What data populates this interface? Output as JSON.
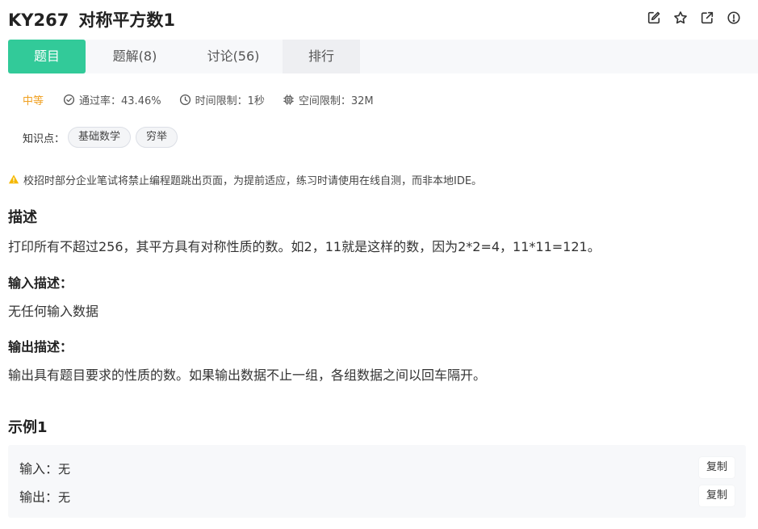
{
  "header": {
    "problem_id": "KY267",
    "problem_title": "对称平方数1",
    "actions": [
      {
        "icon": "edit-icon"
      },
      {
        "icon": "star-icon"
      },
      {
        "icon": "share-icon"
      },
      {
        "icon": "report-icon"
      }
    ]
  },
  "tabs": [
    {
      "label": "题目",
      "active": true
    },
    {
      "label": "题解(8)",
      "active": false
    },
    {
      "label": "讨论(56)",
      "active": false
    },
    {
      "label": "排行",
      "active": false
    }
  ],
  "meta": {
    "difficulty": "中等",
    "pass_rate": "通过率：43.46%",
    "time_limit": "时间限制：1秒",
    "memory_limit": "空间限制：32M"
  },
  "knowledge": {
    "label": "知识点：",
    "tags": [
      "基础数学",
      "穷举"
    ]
  },
  "notice": "校招时部分企业笔试将禁止编程题跳出页面，为提前适应，练习时请使用在线自测，而非本地IDE。",
  "description": {
    "heading": "描述",
    "text": "打印所有不超过256，其平方具有对称性质的数。如2，11就是这样的数，因为2*2=4，11*11=121。"
  },
  "input_desc": {
    "heading": "输入描述：",
    "text": "无任何输入数据"
  },
  "output_desc": {
    "heading": "输出描述：",
    "text": "输出具有题目要求的性质的数。如果输出数据不止一组，各组数据之间以回车隔开。"
  },
  "example": {
    "heading": "示例1",
    "input_label": "输入：",
    "input_value": "无",
    "output_label": "输出：",
    "output_value": "无",
    "copy_label": "复制"
  },
  "colors": {
    "accent": "#32ca99",
    "difficulty": "#f0a020",
    "warning": "#f5b800"
  }
}
